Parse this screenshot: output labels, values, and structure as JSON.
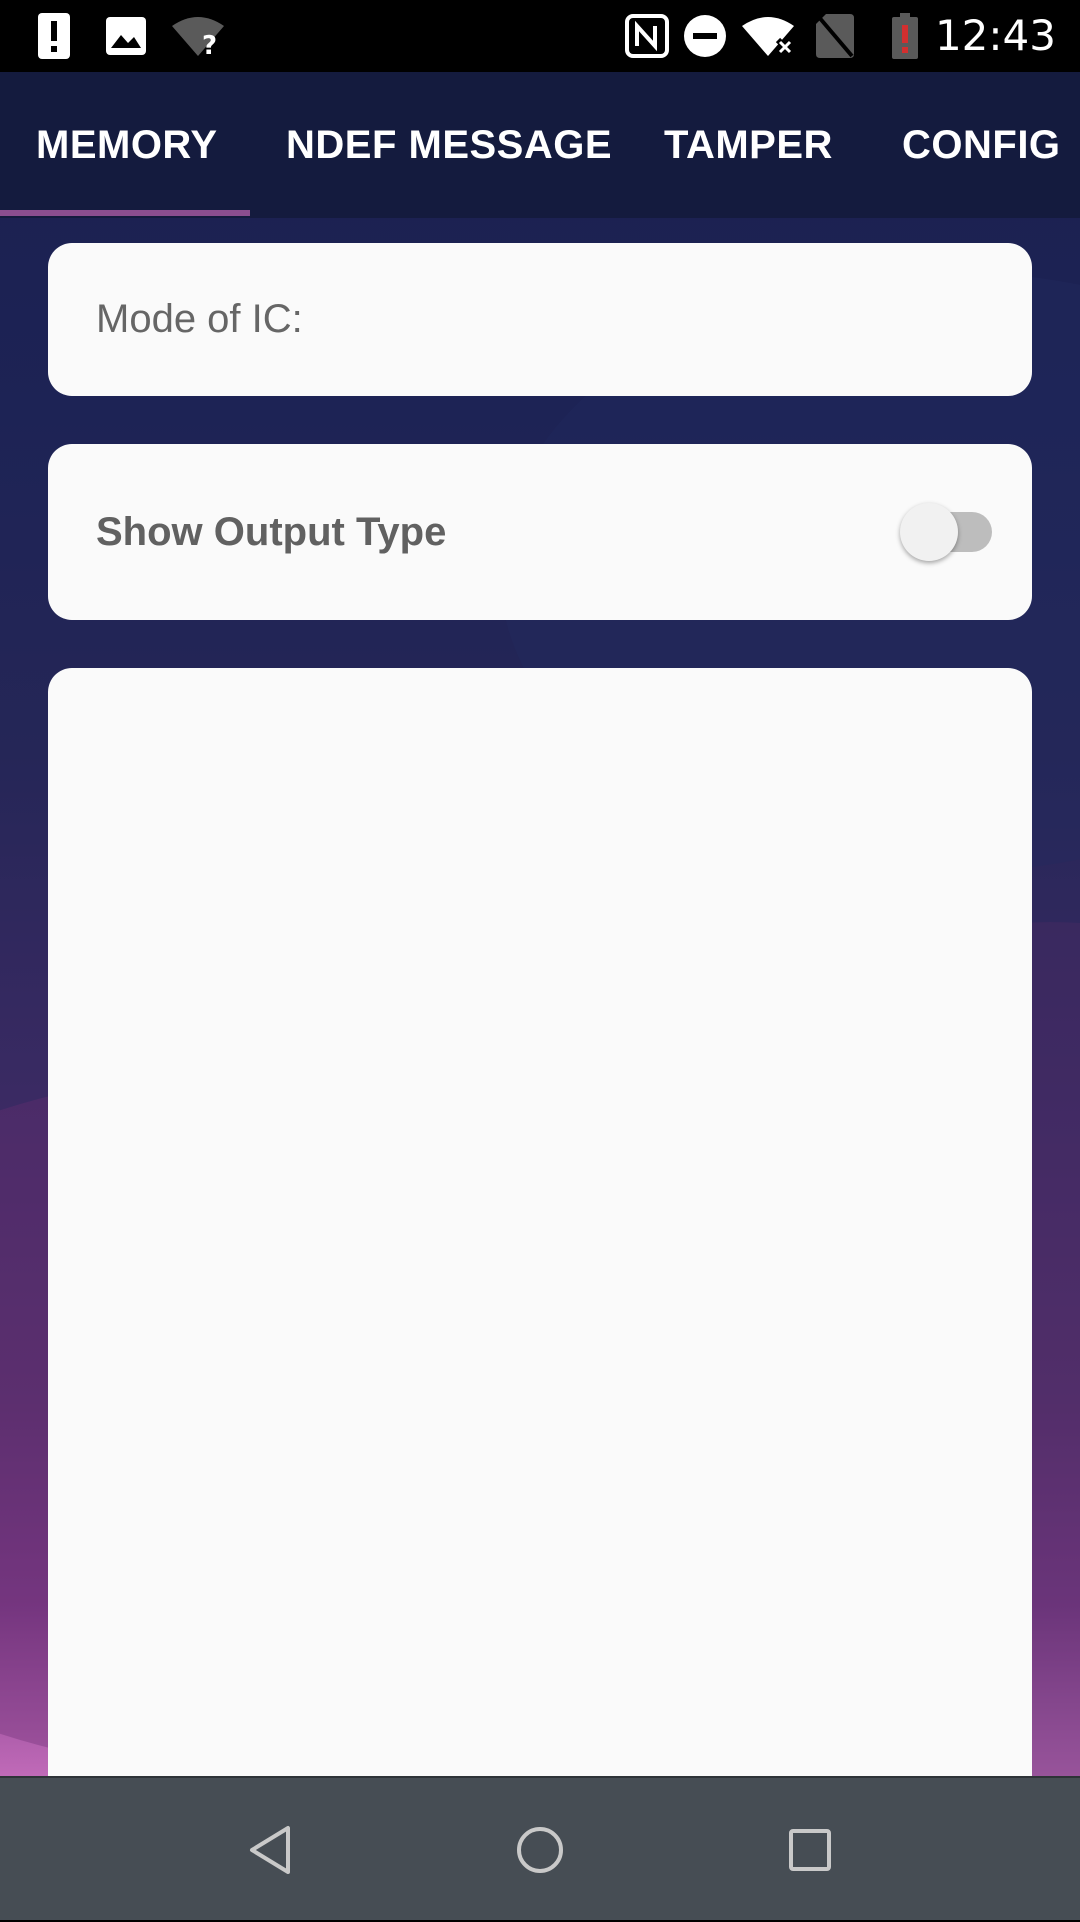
{
  "status_bar": {
    "time": "12:43",
    "left_icons": [
      "alert-icon",
      "image-icon",
      "wifi-unknown-icon"
    ],
    "right_icons": [
      "nfc-icon",
      "do-not-disturb-icon",
      "wifi-off-icon",
      "no-sim-icon",
      "battery-alert-icon"
    ]
  },
  "tabs": [
    {
      "label": "MEMORY",
      "selected": true
    },
    {
      "label": "NDEF MESSAGE",
      "selected": false
    },
    {
      "label": "TAMPER",
      "selected": false
    },
    {
      "label": "CONFIG",
      "selected": false
    }
  ],
  "mode_card": {
    "label": "Mode of IC:"
  },
  "output_card": {
    "label": "Show Output Type",
    "toggle_on": false
  },
  "output_area": {
    "text": ""
  },
  "navbar": {
    "icons": [
      "back-icon",
      "home-icon",
      "recents-icon"
    ]
  },
  "colors": {
    "tab_bar": "#141b3e",
    "tab_indicator": "#8b4e8f",
    "card": "#fafafa",
    "navbar": "#464d54",
    "battery_alert": "#d32f2f"
  }
}
